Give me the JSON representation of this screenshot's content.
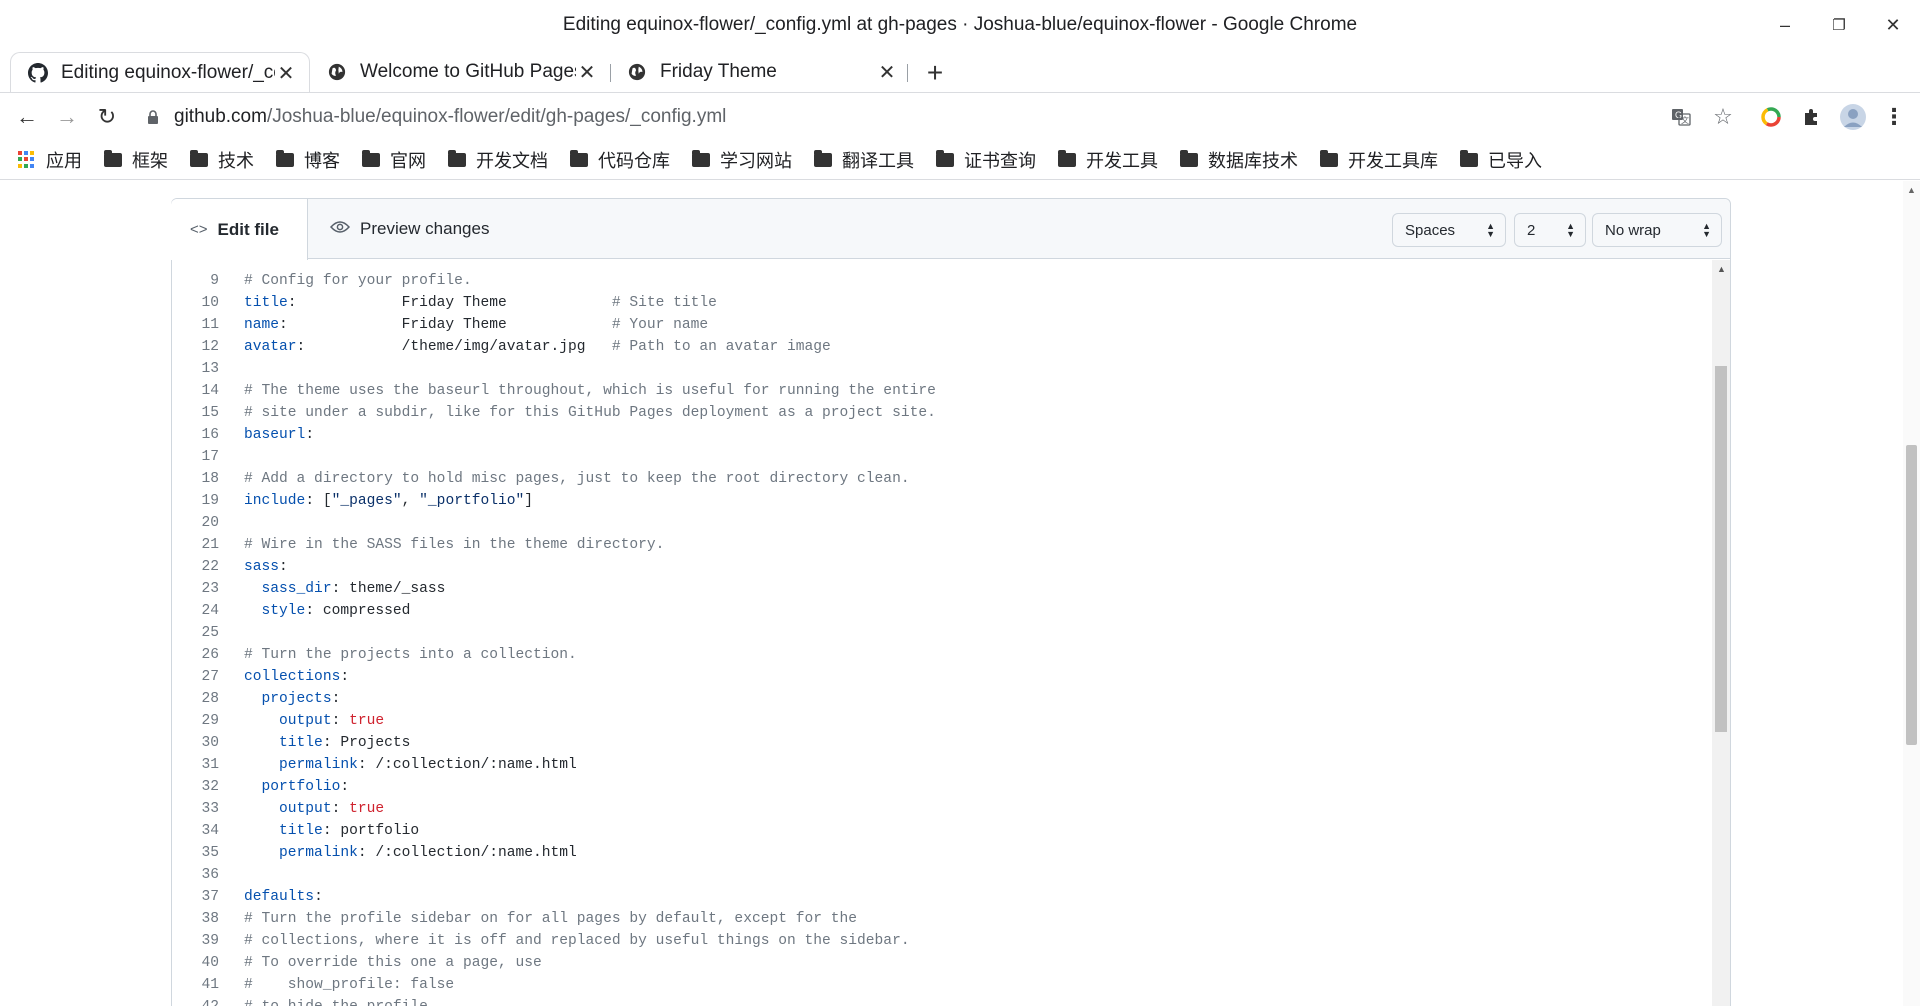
{
  "window": {
    "title": "Editing equinox-flower/_config.yml at gh-pages · Joshua-blue/equinox-flower - Google Chrome",
    "minimize": "–",
    "restore": "❐",
    "close": "✕"
  },
  "tabs": [
    {
      "label": "Editing equinox-flower/_config.yml",
      "icon": "github-icon",
      "close": "✕"
    },
    {
      "label": "Welcome to GitHub Pages",
      "icon": "globe-icon",
      "close": "✕"
    },
    {
      "label": "Friday Theme",
      "icon": "globe-icon",
      "close": "✕"
    }
  ],
  "new_tab": "+",
  "toolbar": {
    "back": "←",
    "forward": "→",
    "reload": "↻",
    "url_host": "github.com",
    "url_path": "/Joshua-blue/equinox-flower/edit/gh-pages/_config.yml",
    "star": "☆",
    "menu": "⋮"
  },
  "bookmarks": [
    {
      "label": "应用",
      "icon": "apps-grid-icon"
    },
    {
      "label": "框架",
      "icon": "folder-icon"
    },
    {
      "label": "技术",
      "icon": "folder-icon"
    },
    {
      "label": "博客",
      "icon": "folder-icon"
    },
    {
      "label": "官网",
      "icon": "folder-icon"
    },
    {
      "label": "开发文档",
      "icon": "folder-icon"
    },
    {
      "label": "代码仓库",
      "icon": "folder-icon"
    },
    {
      "label": "学习网站",
      "icon": "folder-icon"
    },
    {
      "label": "翻译工具",
      "icon": "folder-icon"
    },
    {
      "label": "证书查询",
      "icon": "folder-icon"
    },
    {
      "label": "开发工具",
      "icon": "folder-icon"
    },
    {
      "label": "数据库技术",
      "icon": "folder-icon"
    },
    {
      "label": "开发工具库",
      "icon": "folder-icon"
    },
    {
      "label": "已导入",
      "icon": "folder-icon"
    }
  ],
  "editor": {
    "edit_tab": "Edit file",
    "preview_tab": "Preview changes",
    "indent_mode": "Spaces",
    "indent_size": "2",
    "wrap_mode": "No wrap"
  },
  "colors": {
    "key": "#0550ae",
    "comment": "#6e7781",
    "boolean": "#cf222e",
    "string": "#0a3069"
  },
  "code_lines": [
    {
      "n": "9",
      "parts": [
        {
          "t": "# Config for your profile.",
          "c": "c"
        }
      ]
    },
    {
      "n": "10",
      "parts": [
        {
          "t": "title",
          "c": "k"
        },
        {
          "t": ":            Friday Theme            "
        },
        {
          "t": "# Site title",
          "c": "c"
        }
      ]
    },
    {
      "n": "11",
      "parts": [
        {
          "t": "name",
          "c": "k"
        },
        {
          "t": ":             Friday Theme            "
        },
        {
          "t": "# Your name",
          "c": "c"
        }
      ]
    },
    {
      "n": "12",
      "parts": [
        {
          "t": "avatar",
          "c": "k"
        },
        {
          "t": ":           /theme/img/avatar.jpg   "
        },
        {
          "t": "# Path to an avatar image",
          "c": "c"
        }
      ]
    },
    {
      "n": "13",
      "parts": []
    },
    {
      "n": "14",
      "parts": [
        {
          "t": "# The theme uses the baseurl throughout, which is useful for running the entire",
          "c": "c"
        }
      ]
    },
    {
      "n": "15",
      "parts": [
        {
          "t": "# site under a subdir, like for this GitHub Pages deployment as a project site.",
          "c": "c"
        }
      ]
    },
    {
      "n": "16",
      "parts": [
        {
          "t": "baseurl",
          "c": "k"
        },
        {
          "t": ":"
        }
      ]
    },
    {
      "n": "17",
      "parts": []
    },
    {
      "n": "18",
      "parts": [
        {
          "t": "# Add a directory to hold misc pages, just to keep the root directory clean.",
          "c": "c"
        }
      ]
    },
    {
      "n": "19",
      "parts": [
        {
          "t": "include",
          "c": "k"
        },
        {
          "t": ": ["
        },
        {
          "t": "\"_pages\"",
          "c": "s"
        },
        {
          "t": ", "
        },
        {
          "t": "\"_portfolio\"",
          "c": "s"
        },
        {
          "t": "]"
        }
      ]
    },
    {
      "n": "20",
      "parts": []
    },
    {
      "n": "21",
      "parts": [
        {
          "t": "# Wire in the SASS files in the theme directory.",
          "c": "c"
        }
      ]
    },
    {
      "n": "22",
      "parts": [
        {
          "t": "sass",
          "c": "k"
        },
        {
          "t": ":"
        }
      ]
    },
    {
      "n": "23",
      "parts": [
        {
          "t": "  "
        },
        {
          "t": "sass_dir",
          "c": "k"
        },
        {
          "t": ": theme/_sass"
        }
      ]
    },
    {
      "n": "24",
      "parts": [
        {
          "t": "  "
        },
        {
          "t": "style",
          "c": "k"
        },
        {
          "t": ": compressed"
        }
      ]
    },
    {
      "n": "25",
      "parts": []
    },
    {
      "n": "26",
      "parts": [
        {
          "t": "# Turn the projects into a collection.",
          "c": "c"
        }
      ]
    },
    {
      "n": "27",
      "parts": [
        {
          "t": "collections",
          "c": "k"
        },
        {
          "t": ":"
        }
      ]
    },
    {
      "n": "28",
      "parts": [
        {
          "t": "  "
        },
        {
          "t": "projects",
          "c": "k"
        },
        {
          "t": ":"
        }
      ]
    },
    {
      "n": "29",
      "parts": [
        {
          "t": "    "
        },
        {
          "t": "output",
          "c": "k"
        },
        {
          "t": ": "
        },
        {
          "t": "true",
          "c": "t"
        }
      ]
    },
    {
      "n": "30",
      "parts": [
        {
          "t": "    "
        },
        {
          "t": "title",
          "c": "k"
        },
        {
          "t": ": Projects"
        }
      ]
    },
    {
      "n": "31",
      "parts": [
        {
          "t": "    "
        },
        {
          "t": "permalink",
          "c": "k"
        },
        {
          "t": ": /:collection/:name.html"
        }
      ]
    },
    {
      "n": "32",
      "parts": [
        {
          "t": "  "
        },
        {
          "t": "portfolio",
          "c": "k"
        },
        {
          "t": ":"
        }
      ]
    },
    {
      "n": "33",
      "parts": [
        {
          "t": "    "
        },
        {
          "t": "output",
          "c": "k"
        },
        {
          "t": ": "
        },
        {
          "t": "true",
          "c": "t"
        }
      ]
    },
    {
      "n": "34",
      "parts": [
        {
          "t": "    "
        },
        {
          "t": "title",
          "c": "k"
        },
        {
          "t": ": portfolio"
        }
      ]
    },
    {
      "n": "35",
      "parts": [
        {
          "t": "    "
        },
        {
          "t": "permalink",
          "c": "k"
        },
        {
          "t": ": /:collection/:name.html"
        }
      ]
    },
    {
      "n": "36",
      "parts": []
    },
    {
      "n": "37",
      "parts": [
        {
          "t": "defaults",
          "c": "k"
        },
        {
          "t": ":"
        }
      ]
    },
    {
      "n": "38",
      "parts": [
        {
          "t": "# Turn the profile sidebar on for all pages by default, except for the",
          "c": "c"
        }
      ]
    },
    {
      "n": "39",
      "parts": [
        {
          "t": "# collections, where it is off and replaced by useful things on the sidebar.",
          "c": "c"
        }
      ]
    },
    {
      "n": "40",
      "parts": [
        {
          "t": "# To override this one a page, use",
          "c": "c"
        }
      ]
    },
    {
      "n": "41",
      "parts": [
        {
          "t": "#    show_profile: false",
          "c": "c"
        }
      ]
    },
    {
      "n": "42",
      "parts": [
        {
          "t": "# to hide the profile",
          "c": "c"
        }
      ]
    }
  ]
}
